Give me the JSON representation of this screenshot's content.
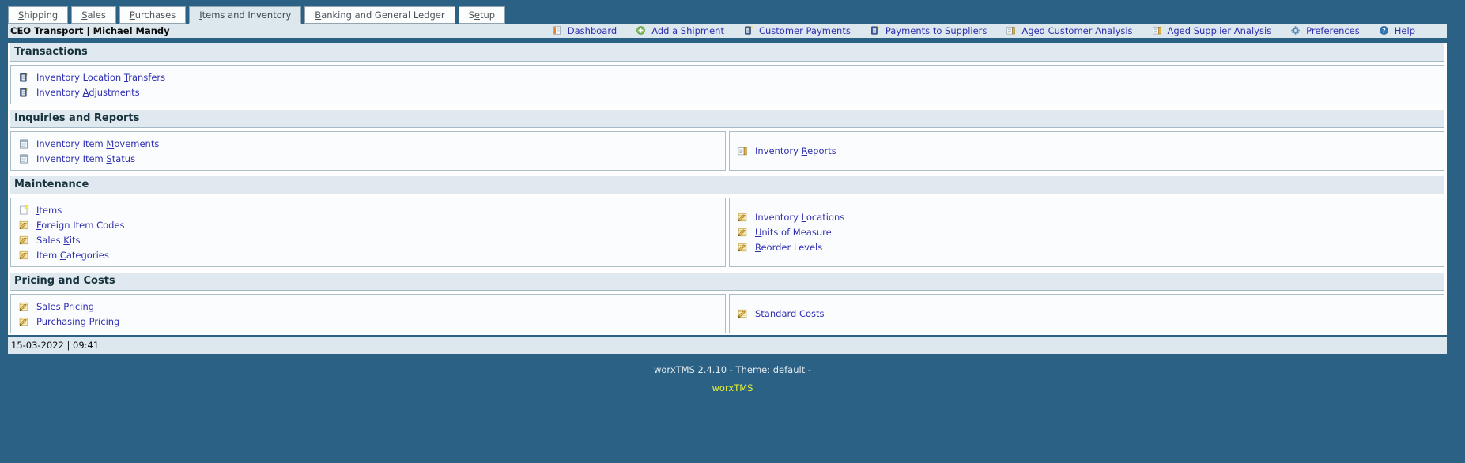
{
  "tabs": [
    {
      "label": "Shipping",
      "accel": 0,
      "active": false
    },
    {
      "label": "Sales",
      "accel": 0,
      "active": false
    },
    {
      "label": "Purchases",
      "accel": 0,
      "active": false
    },
    {
      "label": "Items and Inventory",
      "accel": 0,
      "active": true
    },
    {
      "label": "Banking and General Ledger",
      "accel": 0,
      "active": false
    },
    {
      "label": "Setup",
      "accel": 1,
      "active": false
    }
  ],
  "header": {
    "company": "CEO Transport | Michael Mandy",
    "nav": [
      {
        "label": "Dashboard",
        "icon": "dashboard-icon"
      },
      {
        "label": "Add a Shipment",
        "icon": "add-icon"
      },
      {
        "label": "Customer Payments",
        "icon": "ledger-icon"
      },
      {
        "label": "Payments to Suppliers",
        "icon": "ledger-icon"
      },
      {
        "label": "Aged Customer Analysis",
        "icon": "report-icon"
      },
      {
        "label": "Aged Supplier Analysis",
        "icon": "report-icon"
      },
      {
        "label": "Preferences",
        "icon": "gear-icon"
      },
      {
        "label": "Help",
        "icon": "help-icon"
      }
    ]
  },
  "sections": [
    {
      "title": "Transactions",
      "left": [
        {
          "label": "Inventory Location Transfers",
          "accel": 19,
          "icon": "ledger-icon"
        },
        {
          "label": "Inventory Adjustments",
          "accel": 10,
          "icon": "ledger-icon"
        }
      ],
      "right": []
    },
    {
      "title": "Inquiries and Reports",
      "left": [
        {
          "label": "Inventory Item Movements",
          "accel": 15,
          "icon": "page-icon"
        },
        {
          "label": "Inventory Item Status",
          "accel": 15,
          "icon": "page-icon"
        }
      ],
      "right": [
        {
          "label": "Inventory Reports",
          "accel": 10,
          "icon": "report-icon"
        }
      ]
    },
    {
      "title": "Maintenance",
      "left": [
        {
          "label": "Items",
          "accel": 0,
          "icon": "new-doc-icon"
        },
        {
          "label": "Foreign Item Codes",
          "accel": 0,
          "icon": "edit-icon"
        },
        {
          "label": "Sales Kits",
          "accel": 6,
          "icon": "edit-icon"
        },
        {
          "label": "Item Categories",
          "accel": 5,
          "icon": "edit-icon"
        }
      ],
      "right": [
        {
          "label": "Inventory Locations",
          "accel": 10,
          "icon": "edit-icon"
        },
        {
          "label": "Units of Measure",
          "accel": 0,
          "icon": "edit-icon"
        },
        {
          "label": "Reorder Levels",
          "accel": 0,
          "icon": "edit-icon"
        }
      ]
    },
    {
      "title": "Pricing and Costs",
      "left": [
        {
          "label": "Sales Pricing",
          "accel": 6,
          "icon": "edit-icon"
        },
        {
          "label": "Purchasing Pricing",
          "accel": 11,
          "icon": "edit-icon"
        }
      ],
      "right": [
        {
          "label": "Standard Costs",
          "accel": 9,
          "icon": "edit-icon"
        }
      ]
    }
  ],
  "statusbar": {
    "datetime": "15-03-2022 | 09:41"
  },
  "footer": {
    "version": "worxTMS 2.4.10 - Theme: default -",
    "brand_link": "worxTMS"
  },
  "colors": {
    "frame_blue": "#2c6186",
    "bar_light": "#dce7ee",
    "section_band": "#dfe9ef",
    "link_blue": "#2f2fb0",
    "brand_yellow": "#e6f13c"
  }
}
